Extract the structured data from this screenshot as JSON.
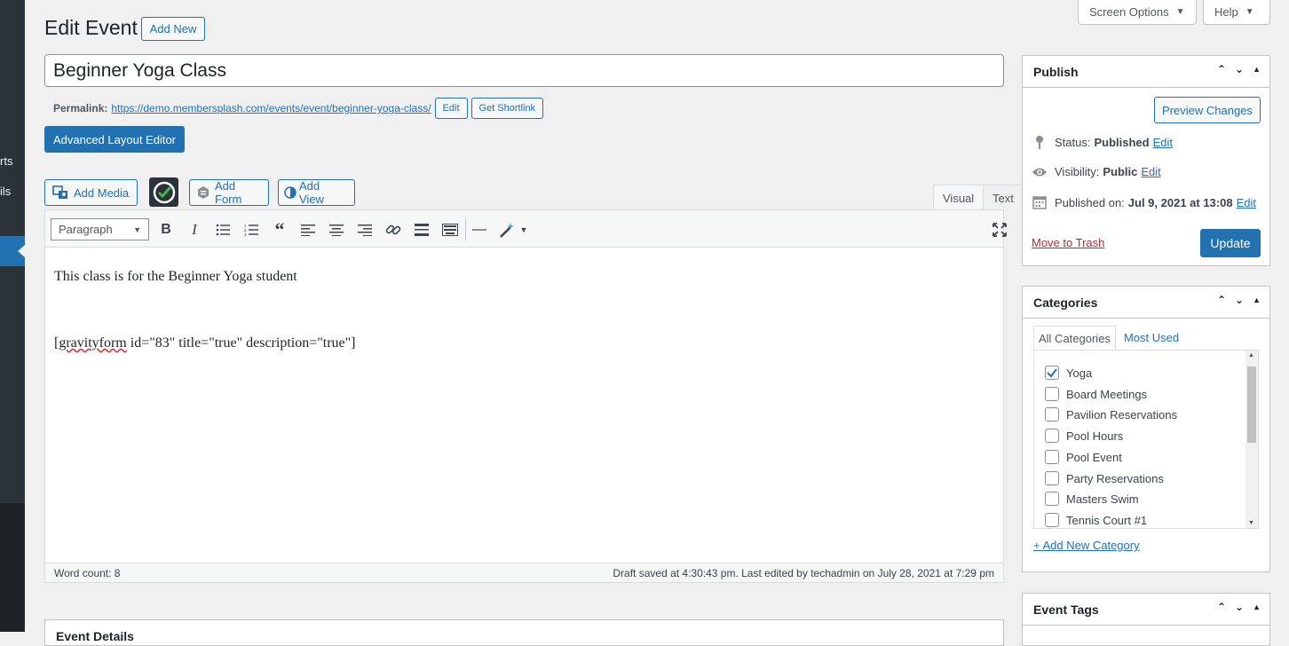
{
  "sidebar": {
    "fragments": [
      "rts",
      "ils"
    ]
  },
  "top_tabs": {
    "screen_options": "Screen Options",
    "help": "Help"
  },
  "header": {
    "title": "Edit Event",
    "add_new": "Add New"
  },
  "post": {
    "title": "Beginner Yoga Class",
    "permalink_label": "Permalink:",
    "permalink_url": "https://demo.membersplash.com/events/event/beginner-yoga-class/",
    "edit_label": "Edit",
    "shortlink_label": "Get Shortlink",
    "advanced_editor": "Advanced Layout Editor"
  },
  "media_buttons": {
    "add_media": "Add Media",
    "add_form": "Add Form",
    "add_view": "Add View"
  },
  "editor": {
    "tab_visual": "Visual",
    "tab_text": "Text",
    "format": "Paragraph",
    "content_line1": "This class is for the Beginner Yoga student",
    "shortcode_open": "[",
    "shortcode_spell": "gravityform",
    "shortcode_rest": " id=\"83\" title=\"true\" description=\"true\"]",
    "word_count": "Word count: 8",
    "draft_status": "Draft saved at 4:30:43 pm. Last edited by techadmin on July 28, 2021 at 7:29 pm"
  },
  "event_details_title": "Event Details",
  "publish": {
    "title": "Publish",
    "preview": "Preview Changes",
    "status_label": "Status:",
    "status_value": "Published",
    "visibility_label": "Visibility:",
    "visibility_value": "Public",
    "published_label": "Published on:",
    "published_value": "Jul 9, 2021 at 13:08",
    "edit": "Edit",
    "trash": "Move to Trash",
    "update": "Update"
  },
  "categories": {
    "title": "Categories",
    "tab_all": "All Categories",
    "tab_most": "Most Used",
    "items": [
      {
        "label": "Yoga",
        "checked": true
      },
      {
        "label": "Board Meetings",
        "checked": false
      },
      {
        "label": "Pavilion Reservations",
        "checked": false
      },
      {
        "label": "Pool Hours",
        "checked": false
      },
      {
        "label": "Pool Event",
        "checked": false
      },
      {
        "label": "Party Reservations",
        "checked": false
      },
      {
        "label": "Masters Swim",
        "checked": false
      },
      {
        "label": "Tennis Court #1",
        "checked": false
      }
    ],
    "add_new": "+ Add New Category"
  },
  "event_tags": {
    "title": "Event Tags"
  },
  "colors": {
    "primary": "#2271b1",
    "trash": "#b32d2e"
  }
}
